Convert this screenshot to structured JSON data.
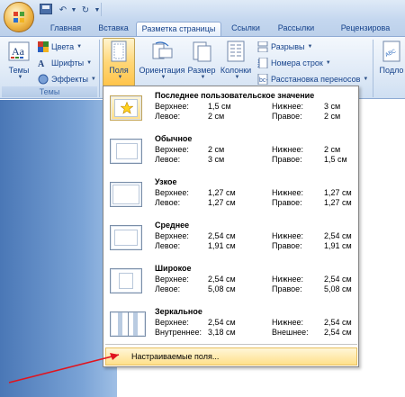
{
  "tabs": [
    {
      "label": "Главная"
    },
    {
      "label": "Вставка"
    },
    {
      "label": "Разметка страницы"
    },
    {
      "label": "Ссылки"
    },
    {
      "label": "Рассылки"
    },
    {
      "label": "Рецензирова"
    }
  ],
  "ribbon": {
    "themes": {
      "big_label": "Темы",
      "colors": "Цвета",
      "fonts": "Шрифты",
      "effects": "Эффекты",
      "group_label": "Темы"
    },
    "margins": "Поля",
    "orientation": "Ориентация",
    "size": "Размер",
    "columns": "Колонки",
    "breaks": "Разрывы",
    "line_numbers": "Номера строк",
    "hyphenation": "Расстановка переносов",
    "right_cut": "Подло"
  },
  "margins_menu": {
    "options": [
      {
        "title": "Последнее пользовательское значение",
        "top_label": "Верхнее:",
        "top": "1,5 см",
        "bottom_label": "Нижнее:",
        "bottom": "3 см",
        "left_label": "Левое:",
        "left": "2 см",
        "right_label": "Правое:",
        "right": "2 см"
      },
      {
        "title": "Обычное",
        "top_label": "Верхнее:",
        "top": "2 см",
        "bottom_label": "Нижнее:",
        "bottom": "2 см",
        "left_label": "Левое:",
        "left": "3 см",
        "right_label": "Правое:",
        "right": "1,5 см"
      },
      {
        "title": "Узкое",
        "top_label": "Верхнее:",
        "top": "1,27 см",
        "bottom_label": "Нижнее:",
        "bottom": "1,27 см",
        "left_label": "Левое:",
        "left": "1,27 см",
        "right_label": "Правое:",
        "right": "1,27 см"
      },
      {
        "title": "Среднее",
        "top_label": "Верхнее:",
        "top": "2,54 см",
        "bottom_label": "Нижнее:",
        "bottom": "2,54 см",
        "left_label": "Левое:",
        "left": "1,91 см",
        "right_label": "Правое:",
        "right": "1,91 см"
      },
      {
        "title": "Широкое",
        "top_label": "Верхнее:",
        "top": "2,54 см",
        "bottom_label": "Нижнее:",
        "bottom": "2,54 см",
        "left_label": "Левое:",
        "left": "5,08 см",
        "right_label": "Правое:",
        "right": "5,08 см"
      },
      {
        "title": "Зеркальное",
        "top_label": "Верхнее:",
        "top": "2,54 см",
        "bottom_label": "Нижнее:",
        "bottom": "2,54 см",
        "left_label": "Внутреннее:",
        "left": "3,18 см",
        "right_label": "Внешнее:",
        "right": "2,54 см"
      }
    ],
    "custom_label": "Настраиваемые поля..."
  },
  "colors": {
    "highlight": "#ffe8a6",
    "accent_arrow": "#e0141e",
    "doc_left": "#4a77b6"
  }
}
